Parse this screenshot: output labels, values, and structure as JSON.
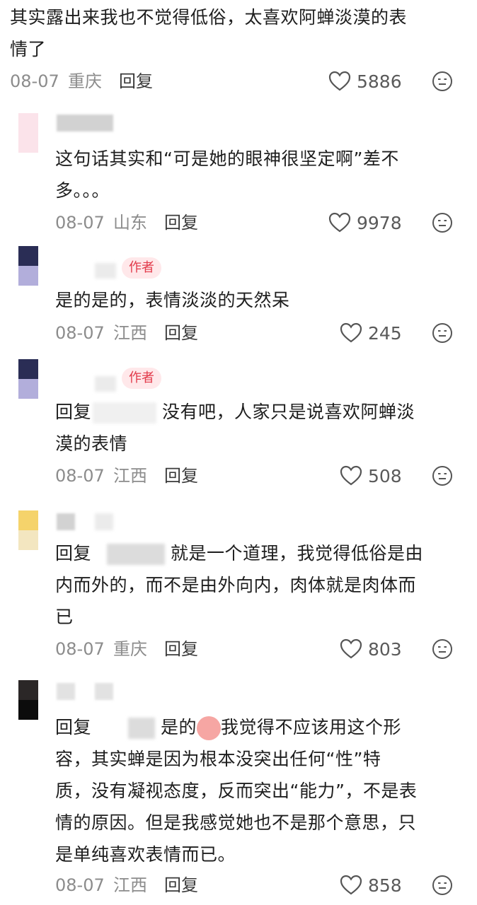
{
  "comments": [
    {
      "lines": [
        "其实露出来我也不觉得低俗，太喜欢阿蝉淡漠的表",
        "情了"
      ],
      "date": "08-07",
      "location": "重庆",
      "reply_label": "回复",
      "likes": "5886"
    },
    {
      "lines": [
        "这句话其实和“可是她的眼神很坚定啊”差不",
        "多。。。"
      ],
      "date": "08-07",
      "location": "山东",
      "reply_label": "回复",
      "likes": "9978"
    },
    {
      "badge": "作者",
      "lines": [
        "是的是的，表情淡淡的天然呆"
      ],
      "date": "08-07",
      "location": "江西",
      "reply_label": "回复",
      "likes": "245"
    },
    {
      "badge": "作者",
      "prefix": "回复",
      "line1_rest": "没有吧，人家只是说喜欢阿蝉淡",
      "lines": [
        "漠的表情"
      ],
      "date": "08-07",
      "location": "江西",
      "reply_label": "回复",
      "likes": "508"
    },
    {
      "prefix": "回复",
      "line1_rest": "就是一个道理，我觉得低俗是由",
      "lines": [
        "内而外的，而不是由外向内，肉体就是肉体而",
        "已"
      ],
      "date": "08-07",
      "location": "重庆",
      "reply_label": "回复",
      "likes": "803"
    },
    {
      "prefix": "回复",
      "line1_rest_a": "是的",
      "line1_rest_b": "我觉得不应该用这个形",
      "lines": [
        "容，其实蝉是因为根本没突出任何“性”特",
        "质，没有凝视态度，反而突出“能力”，不是表",
        "情的原因。但是我感觉她也不是那个意思，只",
        "是单纯喜欢表情而已。"
      ],
      "date": "08-07",
      "location": "江西",
      "reply_label": "回复",
      "likes": "858"
    }
  ],
  "icons": {
    "like": "heart-outline-icon",
    "dislike": "neutral-face-icon",
    "emoji": "crying-face-emoji"
  },
  "colors": {
    "text": "#1e1e1e",
    "meta": "#8c8c8c",
    "badge_bg": "#ffe8ea",
    "badge_text": "#e23a4a"
  }
}
